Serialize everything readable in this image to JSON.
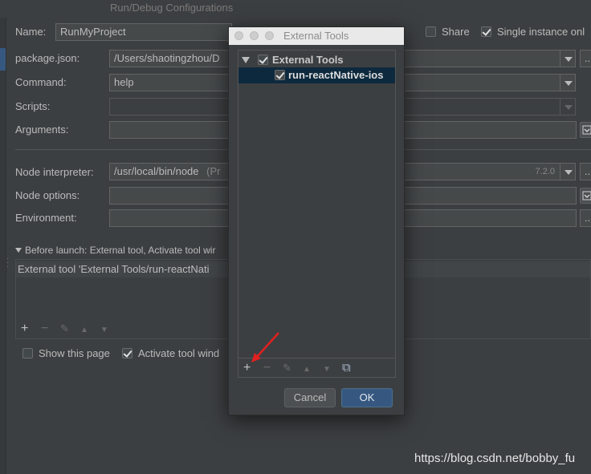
{
  "window": {
    "title": "Run/Debug Configurations"
  },
  "form": {
    "name_label": "Name:",
    "name_value": "RunMyProject",
    "share_label": "Share",
    "single_instance_label": "Single instance onl",
    "packagejson_label": "package.json:",
    "packagejson_value": "/Users/shaotingzhou/D",
    "command_label": "Command:",
    "command_value": "help",
    "scripts_label": "Scripts:",
    "arguments_label": "Arguments:",
    "node_interpreter_label": "Node interpreter:",
    "node_interpreter_value": "/usr/local/bin/node",
    "node_interpreter_hint": "(Pr",
    "node_version": "7.2.0",
    "node_options_label": "Node options:",
    "environment_label": "Environment:",
    "more_label": "..."
  },
  "before_launch": {
    "header": "Before launch: External tool, Activate tool wir",
    "item": "External tool 'External Tools/run-reactNati"
  },
  "bottom": {
    "show_page_label": "Show this page",
    "activate_tool_label": "Activate tool wind"
  },
  "dialog": {
    "title": "External Tools",
    "tree_root": "External Tools",
    "tree_child": "run-reactNative-ios",
    "cancel_label": "Cancel",
    "ok_label": "OK"
  },
  "toolbar": {
    "add": "+",
    "remove": "−",
    "edit": "✎",
    "up": "▲",
    "down": "▼",
    "copy": "⧉"
  },
  "watermark": "https://blog.csdn.net/bobby_fu",
  "colors": {
    "accent": "#365880",
    "ok_button": "#365880",
    "arrow": "#e02020"
  }
}
